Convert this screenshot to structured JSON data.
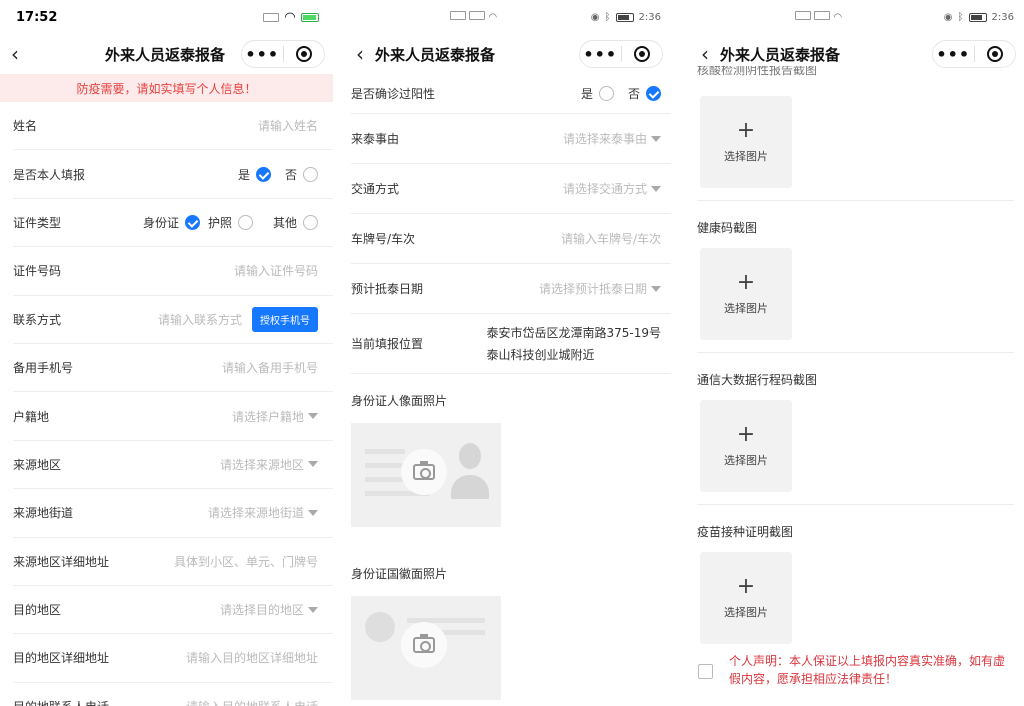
{
  "left": {
    "status": {
      "time": "17:52"
    },
    "nav": {
      "title": "外来人员返泰报备"
    },
    "notice": "防疫需要，请如实填写个人信息！",
    "fields": {
      "name": {
        "label": "姓名",
        "placeholder": "请输入姓名"
      },
      "self": {
        "label": "是否本人填报",
        "yes": "是",
        "no": "否",
        "selected": "是"
      },
      "idtype": {
        "label": "证件类型",
        "opt1": "身份证",
        "opt2": "护照",
        "opt3": "其他",
        "selected": "身份证"
      },
      "idno": {
        "label": "证件号码",
        "placeholder": "请输入证件号码"
      },
      "contact": {
        "label": "联系方式",
        "placeholder": "请输入联系方式",
        "button": "授权手机号"
      },
      "backup": {
        "label": "备用手机号",
        "placeholder": "请输入备用手机号"
      },
      "huji": {
        "label": "户籍地",
        "placeholder": "请选择户籍地"
      },
      "origin": {
        "label": "来源地区",
        "placeholder": "请选择来源地区"
      },
      "street": {
        "label": "来源地街道",
        "placeholder": "请选择来源地街道"
      },
      "origin_addr": {
        "label": "来源地区详细地址",
        "placeholder": "具体到小区、单元、门牌号"
      },
      "dest": {
        "label": "目的地区",
        "placeholder": "请选择目的地区"
      },
      "dest_addr": {
        "label": "目的地区详细地址",
        "placeholder": "请输入目的地区详细地址"
      },
      "dest_phone": {
        "label": "目的地联系人电话",
        "placeholder": "请输入目的地联系人电话"
      }
    }
  },
  "middle": {
    "status": {
      "time": "2:36"
    },
    "nav": {
      "title": "外来人员返泰报备"
    },
    "fields": {
      "positive": {
        "label": "是否确诊过阳性",
        "yes": "是",
        "no": "否",
        "selected": "否"
      },
      "reason": {
        "label": "来泰事由",
        "placeholder": "请选择来泰事由"
      },
      "transport": {
        "label": "交通方式",
        "placeholder": "请选择交通方式"
      },
      "plate": {
        "label": "车牌号/车次",
        "placeholder": "请输入车牌号/车次"
      },
      "date": {
        "label": "预计抵泰日期",
        "placeholder": "请选择预计抵泰日期"
      },
      "location": {
        "label": "当前填报位置",
        "line1": "泰安市岱岳区龙潭南路375-19号",
        "line2": "泰山科技创业城附近"
      }
    },
    "idfront": {
      "label": "身份证人像面照片"
    },
    "idback": {
      "label": "身份证国徽面照片"
    }
  },
  "right": {
    "status": {
      "time": "2:36"
    },
    "nav": {
      "title": "外来人员返泰报备"
    },
    "uploads": [
      {
        "label": "核酸检测阴性报告截图",
        "button": "选择图片"
      },
      {
        "label": "健康码截图",
        "button": "选择图片"
      },
      {
        "label": "通信大数据行程码截图",
        "button": "选择图片"
      },
      {
        "label": "疫苗接种证明截图",
        "button": "选择图片"
      }
    ],
    "declaration": "个人声明：本人保证以上填报内容真实准确，如有虚假内容，愿承担相应法律责任！"
  }
}
